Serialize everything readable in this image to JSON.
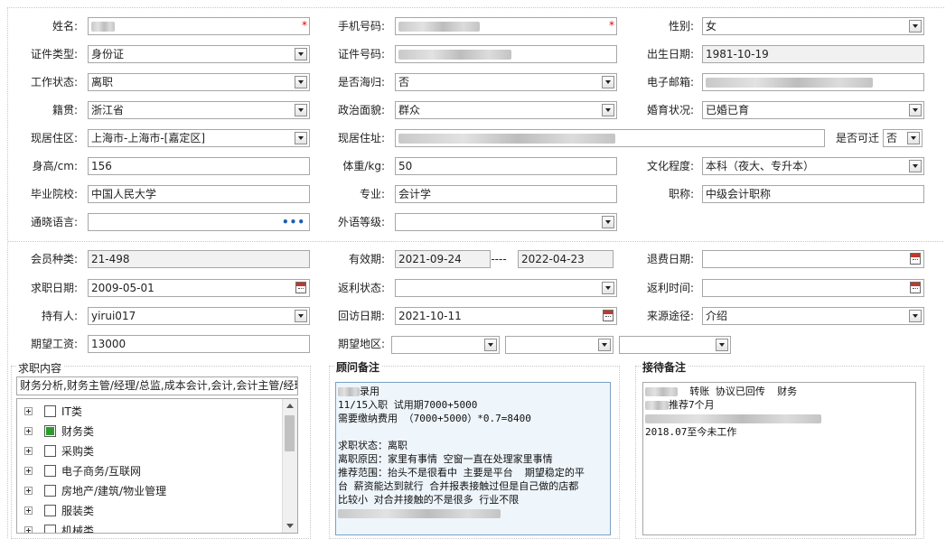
{
  "basic": {
    "name": {
      "label": "姓名:",
      "value": "",
      "required": true
    },
    "phone": {
      "label": "手机号码:",
      "value": "",
      "required": true
    },
    "gender": {
      "label": "性别:",
      "value": "女"
    },
    "id_type": {
      "label": "证件类型:",
      "value": "身份证"
    },
    "id_number": {
      "label": "证件号码:",
      "value": ""
    },
    "birth_date": {
      "label": "出生日期:",
      "value": "1981-10-19"
    },
    "work_status": {
      "label": "工作状态:",
      "value": "离职"
    },
    "overseas_return": {
      "label": "是否海归:",
      "value": "否"
    },
    "email": {
      "label": "电子邮箱:",
      "value": ""
    },
    "native_place": {
      "label": "籍贯:",
      "value": "浙江省"
    },
    "political": {
      "label": "政治面貌:",
      "value": "群众"
    },
    "marital": {
      "label": "婚育状况:",
      "value": "已婚已育"
    },
    "residence_area": {
      "label": "现居住区:",
      "value": "上海市-上海市-[嘉定区]"
    },
    "residence_addr": {
      "label": "现居住址:",
      "value": ""
    },
    "relocate": {
      "label": "是否可迁",
      "value": "否"
    },
    "height": {
      "label": "身高/cm:",
      "value": "156"
    },
    "weight": {
      "label": "体重/kg:",
      "value": "50"
    },
    "education": {
      "label": "文化程度:",
      "value": "本科（夜大、专升本）"
    },
    "school": {
      "label": "毕业院校:",
      "value": "中国人民大学"
    },
    "major": {
      "label": "专业:",
      "value": "会计学"
    },
    "title": {
      "label": "职称:",
      "value": "中级会计职称"
    },
    "language": {
      "label": "通晓语言:",
      "value": ""
    },
    "lang_level": {
      "label": "外语等级:",
      "value": ""
    }
  },
  "member": {
    "type": {
      "label": "会员种类:",
      "value": "21-498"
    },
    "valid": {
      "label": "有效期:",
      "from": "2021-09-24",
      "sep": "----",
      "to": "2022-04-23"
    },
    "refund_date": {
      "label": "退费日期:",
      "value": ""
    },
    "job_date": {
      "label": "求职日期:",
      "value": "2009-05-01"
    },
    "rebate_status": {
      "label": "返利状态:",
      "value": ""
    },
    "rebate_time": {
      "label": "返利时间:",
      "value": ""
    },
    "holder": {
      "label": "持有人:",
      "value": "yirui017"
    },
    "visit_date": {
      "label": "回访日期:",
      "value": "2021-10-11"
    },
    "source": {
      "label": "来源途径:",
      "value": "介绍"
    },
    "salary": {
      "label": "期望工资:",
      "value": "13000"
    },
    "region": {
      "label": "期望地区:",
      "value": ""
    }
  },
  "job_content": {
    "title": "求职内容",
    "summary": "财务分析,财务主管/经理/总监,成本会计,会计,会计主管/经理",
    "items": [
      {
        "label": "IT类",
        "checked": false
      },
      {
        "label": "财务类",
        "checked": true
      },
      {
        "label": "采购类",
        "checked": false
      },
      {
        "label": "电子商务/互联网",
        "checked": false
      },
      {
        "label": "房地产/建筑/物业管理",
        "checked": false
      },
      {
        "label": "服装类",
        "checked": false
      },
      {
        "label": "机械类",
        "checked": false
      }
    ]
  },
  "consultant_notes": {
    "title": "顾问备注",
    "lines": [
      "录用",
      "11/15入职 试用期7000+5000",
      "需要缴纳费用 （7000+5000）*0.7=8400",
      "",
      "求职状态：离职",
      "离职原因：家里有事情 空窗一直在处理家里事情",
      "推荐范围：抬头不是很看中 主要是平台  期望稳定的平",
      "台 薪资能达到就行 合并报表接触过但是自己做的店都",
      "比较小 对合并接触的不是很多 行业不限"
    ]
  },
  "reception_notes": {
    "title": "接待备注",
    "lines": [
      "转账 协议已回传  财务",
      "推荐7个月",
      "",
      "2018.07至今未工作"
    ]
  }
}
